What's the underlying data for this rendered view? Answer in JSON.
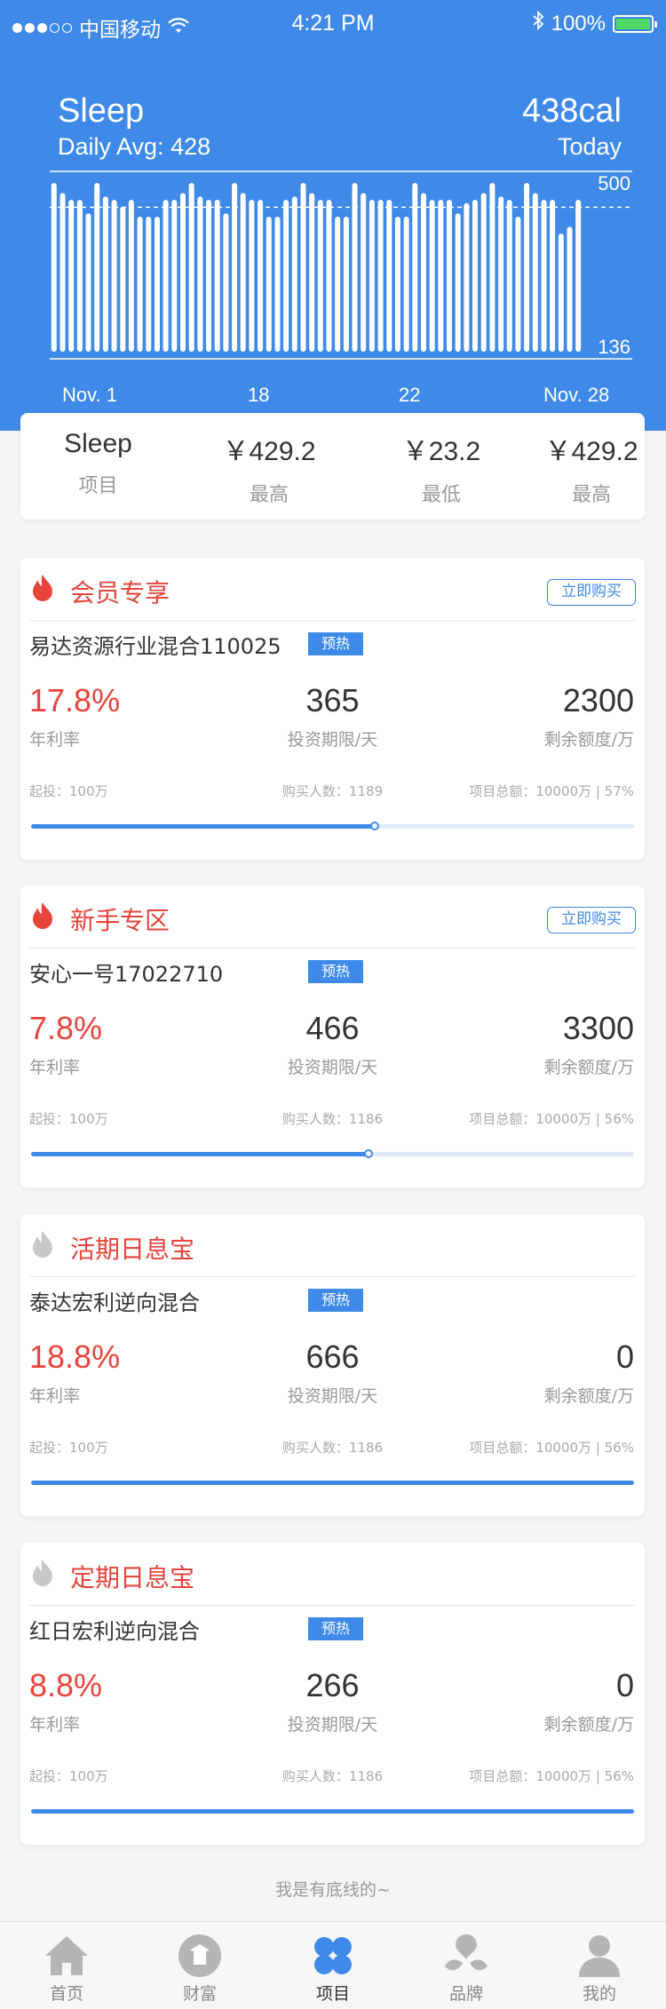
{
  "status_bar": {
    "carrier": "中国移动",
    "time": "4:21 PM",
    "battery": "100%"
  },
  "hero": {
    "title": "Sleep",
    "daily_avg": "Daily Avg: 428",
    "calories": "438cal",
    "today": "Today",
    "x_labels": [
      "Nov. 1",
      "18",
      "22",
      "Nov. 28"
    ]
  },
  "chart_data": {
    "type": "bar",
    "title": "Sleep",
    "y_max_label": "500",
    "y_min_label": "136",
    "ylim": [
      0,
      500
    ],
    "average_line": 428,
    "values": [
      500,
      470,
      450,
      450,
      410,
      500,
      460,
      450,
      430,
      450,
      400,
      400,
      400,
      450,
      450,
      470,
      500,
      460,
      450,
      450,
      410,
      500,
      470,
      450,
      450,
      400,
      400,
      450,
      460,
      500,
      470,
      450,
      450,
      400,
      400,
      500,
      470,
      450,
      450,
      450,
      400,
      400,
      500,
      470,
      450,
      450,
      450,
      410,
      440,
      450,
      470,
      500,
      460,
      450,
      400,
      500,
      470,
      450,
      450,
      350,
      370,
      450
    ],
    "colors": {
      "bar": "#ffffff",
      "background": "#3f8ae8"
    }
  },
  "summary": {
    "items": [
      {
        "value": "Sleep",
        "label": "项目"
      },
      {
        "value": "￥429.2",
        "label": "最高"
      },
      {
        "value": "￥23.2",
        "label": "最低"
      },
      {
        "value": "￥429.2",
        "label": "最高"
      }
    ]
  },
  "products": [
    {
      "title": "会员专享",
      "flame_color": "#e8443c",
      "buy_label": "立即购买",
      "name": "易达资源行业混合110025",
      "tag": "预热",
      "rate": "17.8%",
      "rate_label": "年利率",
      "term": "365",
      "term_label": "投资期限/天",
      "remain": "2300",
      "remain_label": "剩余额度/万",
      "min_invest": "起投：100万",
      "buyers": "购买人数：1189",
      "total": "项目总额：10000万 | 57%",
      "progress": 0.57
    },
    {
      "title": "新手专区",
      "flame_color": "#e8443c",
      "buy_label": "立即购买",
      "name": "安心一号17022710",
      "tag": "预热",
      "rate": "7.8%",
      "rate_label": "年利率",
      "term": "466",
      "term_label": "投资期限/天",
      "remain": "3300",
      "remain_label": "剩余额度/万",
      "min_invest": "起投：100万",
      "buyers": "购买人数：1186",
      "total": "项目总额：10000万 | 56%",
      "progress": 0.56
    },
    {
      "title": "活期日息宝",
      "flame_color": "#c8c8c8",
      "buy_label": "",
      "name": "泰达宏利逆向混合",
      "tag": "预热",
      "rate": "18.8%",
      "rate_label": "年利率",
      "term": "666",
      "term_label": "投资期限/天",
      "remain": "0",
      "remain_label": "剩余额度/万",
      "min_invest": "起投：100万",
      "buyers": "购买人数：1186",
      "total": "项目总额：10000万 | 56%",
      "progress": 1.0
    },
    {
      "title": "定期日息宝",
      "flame_color": "#c8c8c8",
      "buy_label": "",
      "name": "红日宏利逆向混合",
      "tag": "预热",
      "rate": "8.8%",
      "rate_label": "年利率",
      "term": "266",
      "term_label": "投资期限/天",
      "remain": "0",
      "remain_label": "剩余额度/万",
      "min_invest": "起投：100万",
      "buyers": "购买人数：1186",
      "total": "项目总额：10000万 | 56%",
      "progress": 1.0
    }
  ],
  "footer_note": "我是有底线的~",
  "tabbar": {
    "tabs": [
      {
        "label": "首页",
        "icon": "home-icon",
        "active": false
      },
      {
        "label": "财富",
        "icon": "wealth-icon",
        "active": false
      },
      {
        "label": "项目",
        "icon": "project-icon",
        "active": true
      },
      {
        "label": "品牌",
        "icon": "brand-icon",
        "active": false
      },
      {
        "label": "我的",
        "icon": "profile-icon",
        "active": false
      }
    ],
    "active_color": "#3f8ae8",
    "inactive_color": "#b5b5b5"
  }
}
